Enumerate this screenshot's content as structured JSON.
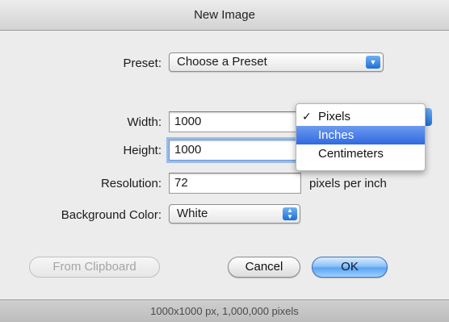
{
  "window": {
    "title": "New Image"
  },
  "form": {
    "preset": {
      "label": "Preset:",
      "value": "Choose a Preset",
      "arrow_icon": "chevron-down-icon"
    },
    "width": {
      "label": "Width:",
      "value": "1000"
    },
    "height": {
      "label": "Height:",
      "value": "1000"
    },
    "resolution": {
      "label": "Resolution:",
      "value": "72",
      "unit": "pixels per inch"
    },
    "background": {
      "label": "Background Color:",
      "value": "White",
      "arrow_icon": "updown-arrows-icon"
    }
  },
  "unit_menu": {
    "items": [
      {
        "label": "Pixels",
        "checked": true
      },
      {
        "label": "Inches",
        "highlighted": true
      },
      {
        "label": "Centimeters"
      }
    ]
  },
  "buttons": {
    "from_clipboard": "From Clipboard",
    "cancel": "Cancel",
    "ok": "OK"
  },
  "status": {
    "text": "1000x1000 px, 1,000,000 pixels"
  },
  "colors": {
    "accent": "#2f6ae0",
    "window_bg": "#ececec"
  }
}
